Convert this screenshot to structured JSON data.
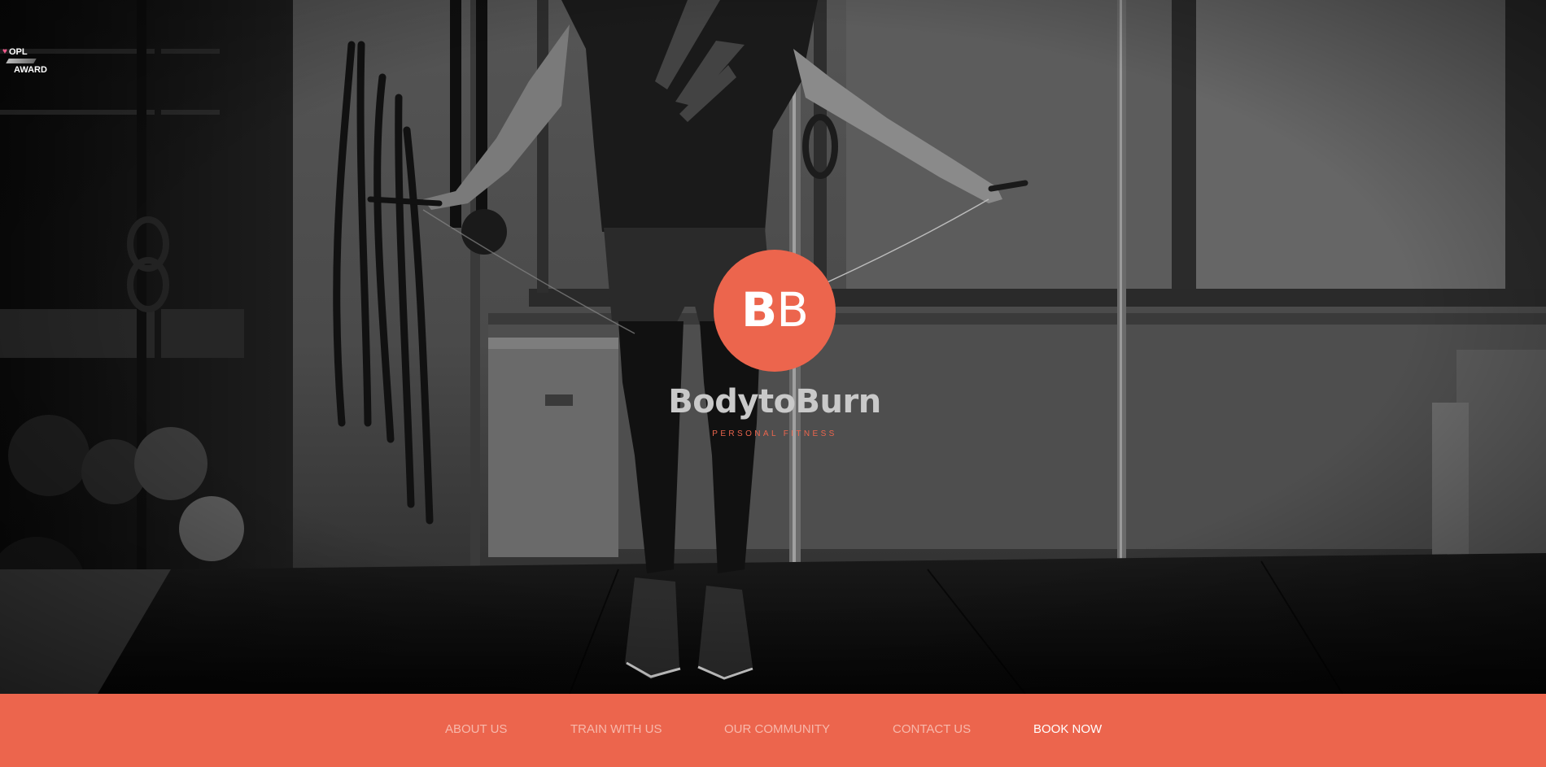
{
  "award": {
    "line1": "OPL",
    "line2": "AWARD",
    "heart_icon": "heart-icon",
    "heart_color": "#f05a8c"
  },
  "logo": {
    "monogram_first": "B",
    "monogram_second": "B",
    "name": "BodytoBurn",
    "tagline": "PERSONAL FITNESS",
    "accent_color": "#ec654d"
  },
  "nav": {
    "items": [
      {
        "label": "ABOUT US"
      },
      {
        "label": "TRAIN WITH US"
      },
      {
        "label": "OUR COMMUNITY"
      },
      {
        "label": "CONTACT US"
      },
      {
        "label": "BOOK NOW"
      }
    ],
    "background_color": "#ec654d"
  }
}
